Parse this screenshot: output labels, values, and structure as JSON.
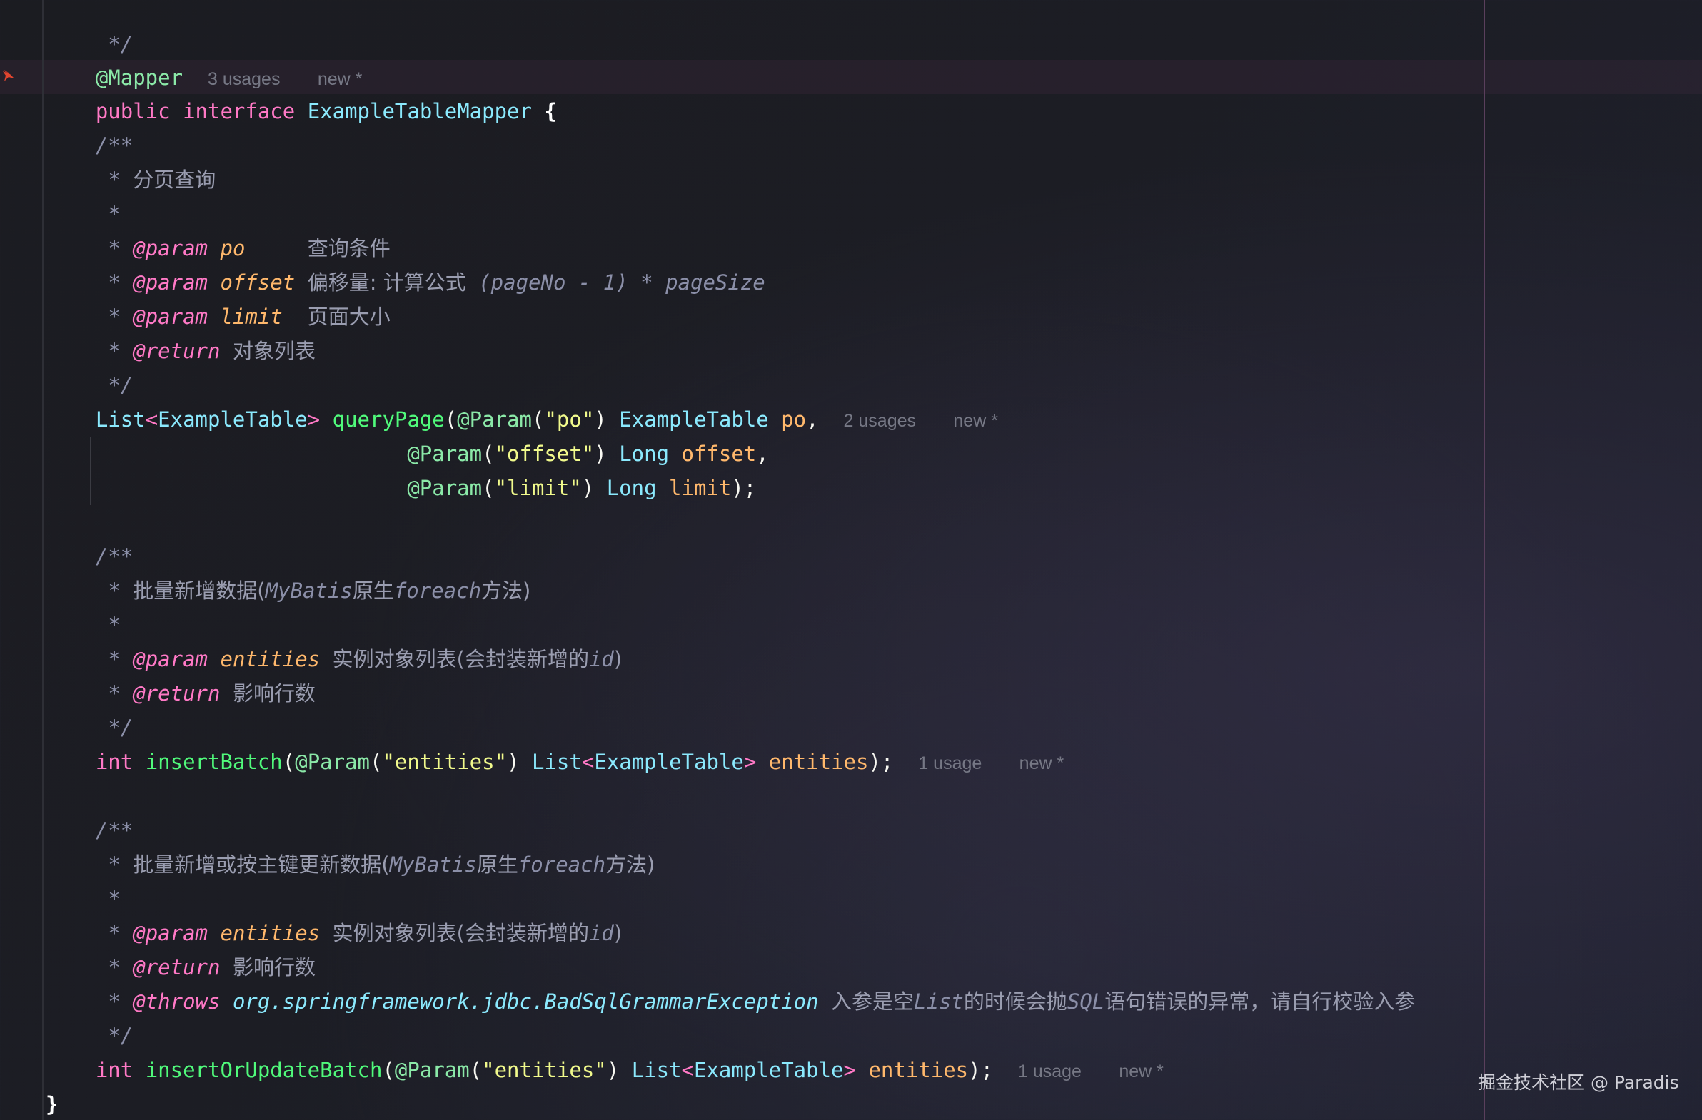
{
  "code": {
    "l0": " */",
    "l1_annotation": "@Mapper",
    "l1_usages": "3 usages",
    "l1_new": "new *",
    "l2_public": "public",
    "l2_interface": "interface",
    "l2_name": "ExampleTableMapper",
    "l2_brace": "{",
    "c1": {
      "open": "/**",
      "desc": "分页查询",
      "star": "*",
      "p1_tag": "@param",
      "p1_name": "po",
      "p1_desc": "查询条件",
      "p2_tag": "@param",
      "p2_name": "offset",
      "p2_desc": "偏移量: 计算公式",
      "p2_formula": "(pageNo - 1) * pageSize",
      "p3_tag": "@param",
      "p3_name": "limit",
      "p3_desc": "页面大小",
      "ret_tag": "@return",
      "ret_desc": "对象列表",
      "close": "*/"
    },
    "m1": {
      "list": "List",
      "lt": "<",
      "type": "ExampleTable",
      "gt": ">",
      "name": "queryPage",
      "paren": "(",
      "param_ann": "@Param",
      "po_str": "\"po\"",
      "po_type": "ExampleTable",
      "po_var": "po",
      "comma": ",",
      "usages": "2 usages",
      "new": "new *",
      "offset_str": "\"offset\"",
      "long": "Long",
      "offset_var": "offset",
      "limit_str": "\"limit\"",
      "limit_var": "limit",
      "end": ");"
    },
    "c2": {
      "open": "/**",
      "desc": "批量新增数据",
      "desc_note_open": "(",
      "desc_note_mybatis": "MyBatis",
      "desc_note_mid": "原生",
      "desc_note_foreach": "foreach",
      "desc_note_end": "方法)",
      "star": "*",
      "p_tag": "@param",
      "p_name": "entities",
      "p_desc": "实例对象列表(会封装新增的",
      "p_desc_id": "id",
      "p_desc_end": ")",
      "ret_tag": "@return",
      "ret_desc": "影响行数",
      "close": "*/"
    },
    "m2": {
      "int": "int",
      "name": "insertBatch",
      "usages": "1 usage",
      "new": "new *"
    },
    "c3": {
      "open": "/**",
      "desc": "批量新增或按主键更新数据",
      "desc_note_open": "(",
      "desc_note_mybatis": "MyBatis",
      "desc_note_mid": "原生",
      "desc_note_foreach": "foreach",
      "desc_note_end": "方法)",
      "star": "*",
      "p_tag": "@param",
      "p_name": "entities",
      "p_desc": "实例对象列表(会封装新增的",
      "p_desc_id": "id",
      "p_desc_end": ")",
      "ret_tag": "@return",
      "ret_desc": "影响行数",
      "throws_tag": "@throws",
      "throws_exc": "org.springframework.jdbc.BadSqlGrammarException",
      "throws_desc1": "入参是空",
      "throws_list": "List",
      "throws_desc2": "的时候会抛",
      "throws_sql": "SQL",
      "throws_desc3": "语句错误的异常，请自行校验入参",
      "close": "*/"
    },
    "m3": {
      "int": "int",
      "name": "insertOrUpdateBatch",
      "usages": "1 usage",
      "new": "new *"
    },
    "entities_str": "\"entities\"",
    "entities_var": "entities",
    "param_ann": "@Param",
    "list": "List",
    "type": "ExampleTable",
    "close_brace": "}"
  },
  "watermark": "掘金技术社区 @ Paradis",
  "colors": {
    "background": "#191a20",
    "keyword": "#ff79c6",
    "type": "#8be9fd",
    "function": "#50fa7b",
    "string": "#f1fa8c",
    "variable": "#ffb86c",
    "comment": "#8b8fa8"
  }
}
